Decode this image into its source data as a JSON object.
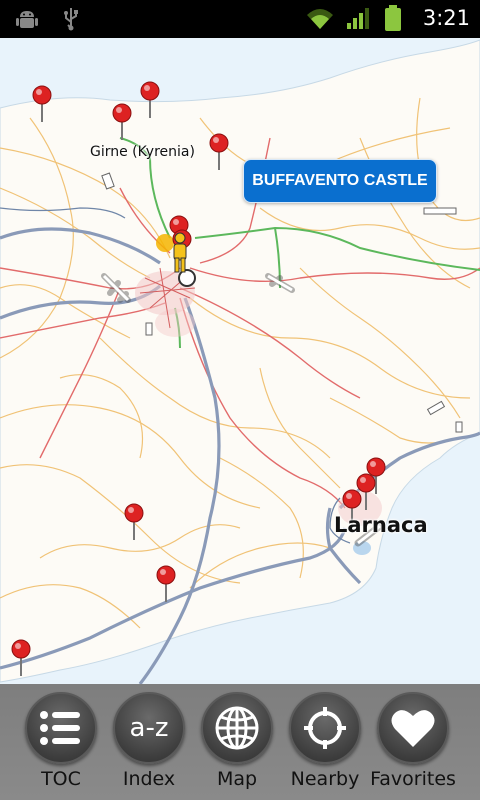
{
  "status_bar": {
    "time": "3:21",
    "icons": [
      "android-debug-icon",
      "usb-icon",
      "wifi-icon",
      "signal-icon",
      "battery-icon"
    ]
  },
  "map": {
    "labels": {
      "kyrenia": "Girne (Kyrenia)",
      "larnaca": "Larnaca"
    },
    "callout": "BUFFAVENTO CASTLE",
    "colors": {
      "sea": "#e8f3fb",
      "land": "#fdfbf6",
      "highway": "#8a9ab8",
      "main_road": "#e26b6b",
      "minor_road": "#f0c070",
      "green_road": "#5cb85c",
      "callout": "#0a6fcf"
    }
  },
  "toolbar": {
    "items": [
      {
        "label": "TOC",
        "icon": "list-icon"
      },
      {
        "label": "Index",
        "icon": "a-z-icon",
        "glyph": "a-z"
      },
      {
        "label": "Map",
        "icon": "globe-icon"
      },
      {
        "label": "Nearby",
        "icon": "crosshair-icon"
      },
      {
        "label": "Favorites",
        "icon": "heart-icon"
      }
    ]
  }
}
